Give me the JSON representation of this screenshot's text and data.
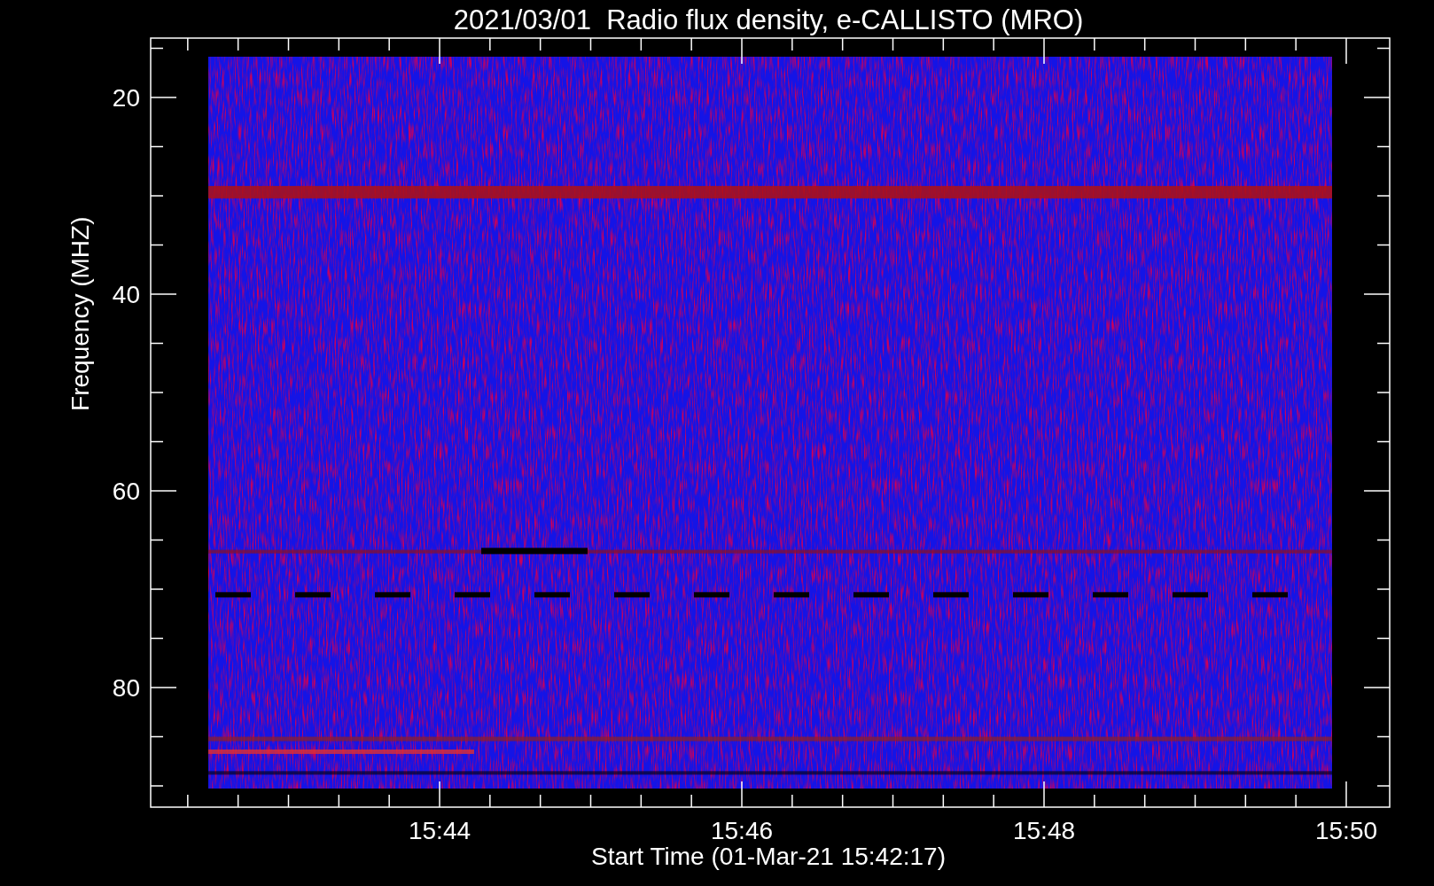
{
  "title": "2021/03/01  Radio flux density, e-CALLISTO (MRO)",
  "y_axis": {
    "label": "Frequency (MHZ)",
    "ticks": [
      "20",
      "40",
      "60",
      "80"
    ]
  },
  "x_axis": {
    "label": "Start Time (01-Mar-21 15:42:17)",
    "ticks": [
      "15:44",
      "15:46",
      "15:48",
      "15:50"
    ]
  }
}
